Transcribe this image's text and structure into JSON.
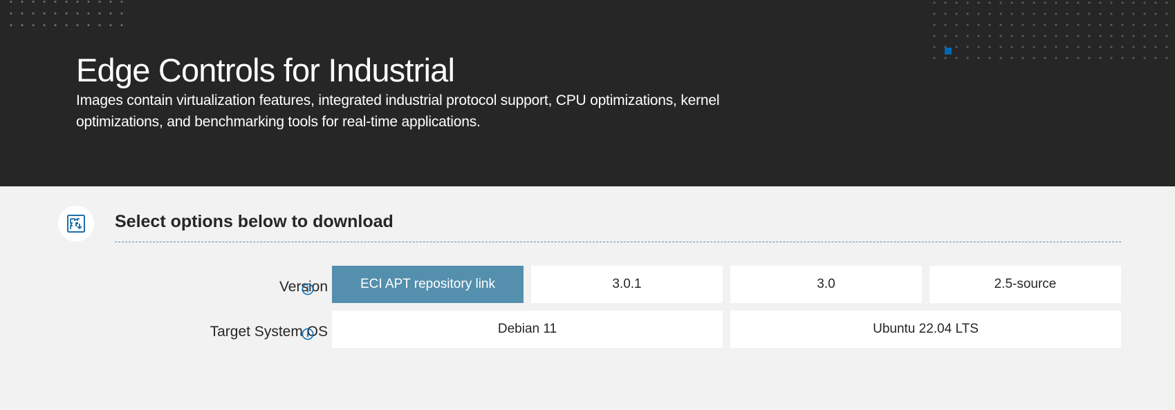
{
  "hero": {
    "title": "Edge Controls for Industrial",
    "description": "Images contain virtualization features, integrated industrial protocol support, CPU optimizations, kernel optimizations, and benchmarking tools for real-time applications."
  },
  "section": {
    "icon": "puzzle-download-icon",
    "title": "Select options below to download"
  },
  "version": {
    "label": "Version",
    "info_icon": "info-icon",
    "selected": "ECI APT repository link",
    "options": [
      "ECI APT repository link",
      "3.0.1",
      "3.0",
      "2.5-source"
    ]
  },
  "target_os": {
    "label": "Target System OS",
    "info_icon": "info-icon",
    "options": [
      "Debian 11",
      "Ubuntu 22.04 LTS"
    ]
  },
  "colors": {
    "hero_bg": "#262626",
    "page_bg": "#f2f2f2",
    "selected_bg": "#548fad",
    "accent_blue": "#0068b5",
    "option_bg": "#ffffff"
  }
}
